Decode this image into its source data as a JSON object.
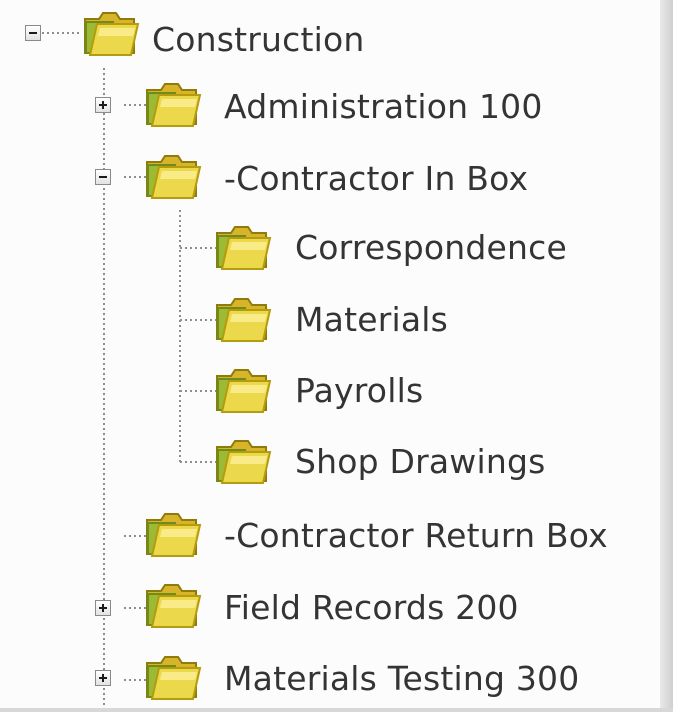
{
  "tree": {
    "root": {
      "label": "Construction",
      "state": "expanded",
      "icon": "folder-icon"
    },
    "items": [
      {
        "label": "Administration 100",
        "state": "collapsed",
        "icon": "folder-icon"
      },
      {
        "label": "-Contractor In Box",
        "state": "expanded",
        "icon": "folder-icon"
      },
      {
        "label": "Correspondence",
        "state": "leaf",
        "icon": "folder-icon"
      },
      {
        "label": "Materials",
        "state": "leaf",
        "icon": "folder-icon"
      },
      {
        "label": "Payrolls",
        "state": "leaf",
        "icon": "folder-icon"
      },
      {
        "label": "Shop Drawings",
        "state": "leaf",
        "icon": "folder-icon"
      },
      {
        "label": "-Contractor Return Box",
        "state": "leaf",
        "icon": "folder-icon"
      },
      {
        "label": "Field Records 200",
        "state": "collapsed",
        "icon": "folder-icon"
      },
      {
        "label": "Materials Testing 300",
        "state": "collapsed",
        "icon": "folder-icon"
      }
    ]
  },
  "colors": {
    "folder_light": "#ecd84b",
    "folder_dark": "#b59b0e",
    "folder_green": "#79952a",
    "text": "#343434",
    "tree_line": "#8d8d8d"
  }
}
